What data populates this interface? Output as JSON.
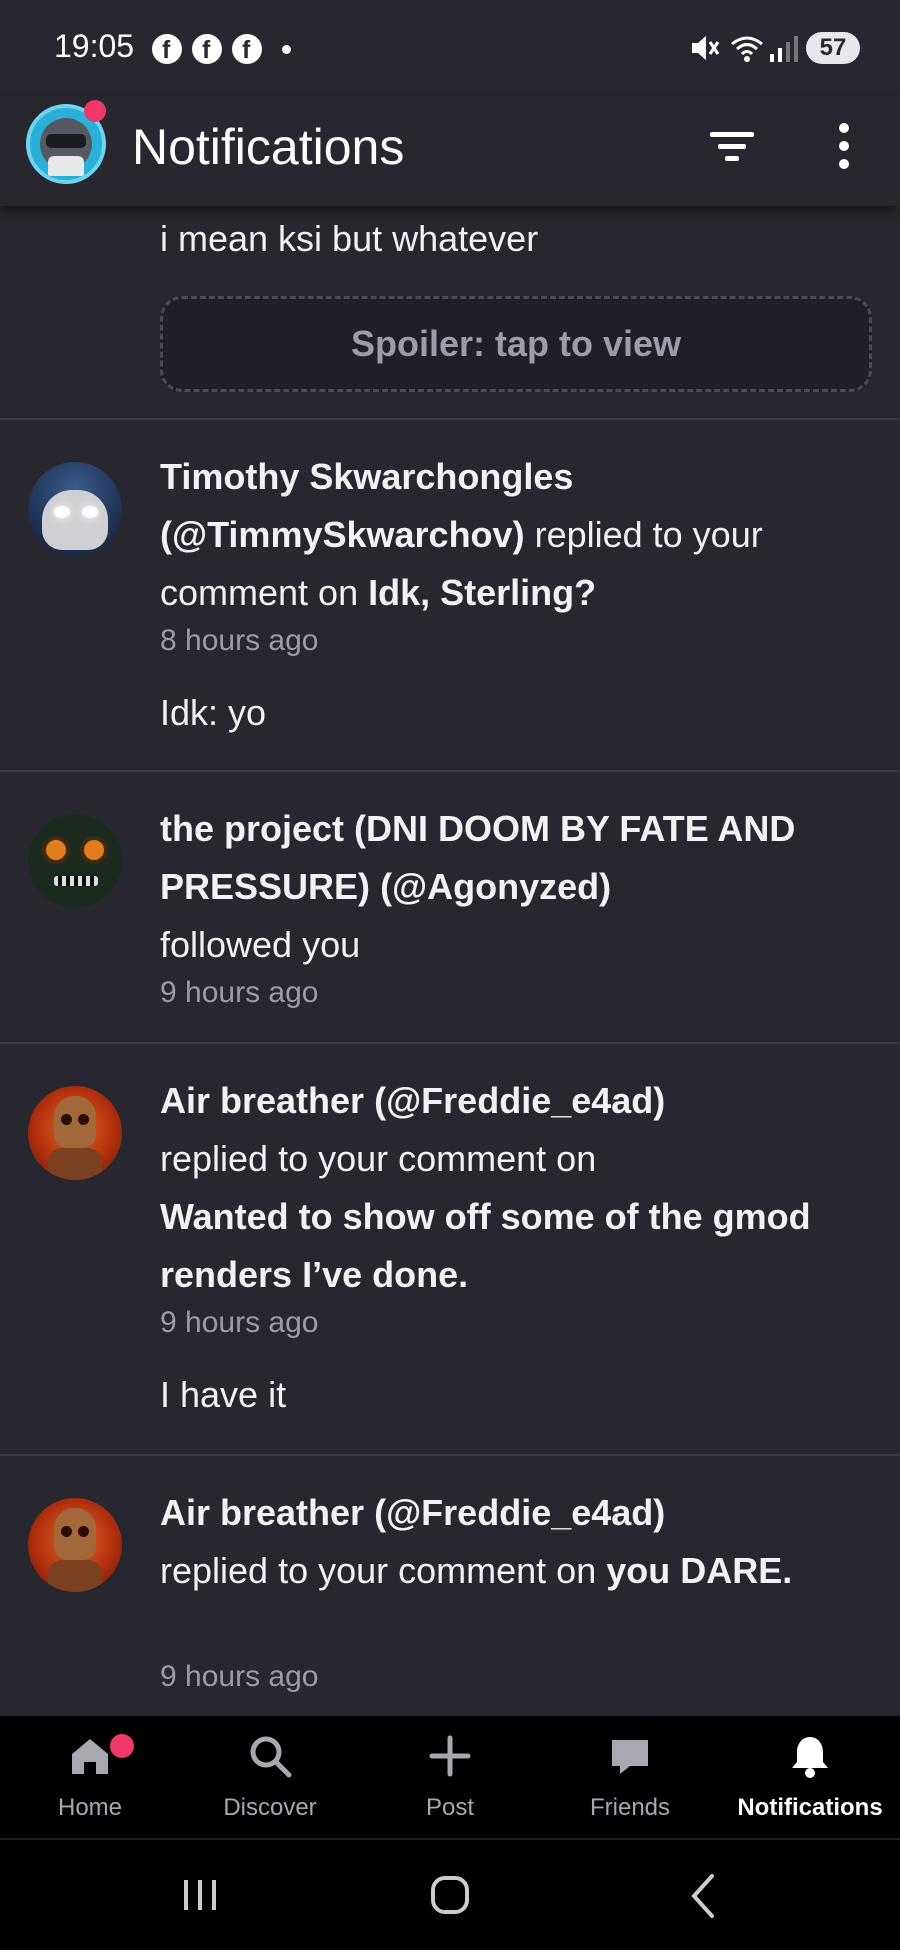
{
  "status_bar": {
    "time": "19:05",
    "battery": "57",
    "notification_icons": [
      "facebook-icon",
      "facebook-icon",
      "facebook-icon"
    ]
  },
  "header": {
    "title": "Notifications"
  },
  "top_snippet": {
    "text": "i mean ksi but whatever",
    "spoiler_label": "Spoiler: tap to view"
  },
  "notifications": [
    {
      "user": "Timothy Skwarchongles",
      "handle": "(@TimmySkwarchov)",
      "action": "replied to your comment on",
      "target": "Idk, Sterling?",
      "time": "8 hours ago",
      "reply": "Idk: yo"
    },
    {
      "user": "the project (DNI DOOM BY FATE AND PRESSURE)",
      "handle": "(@Agonyzed)",
      "action": "followed you",
      "time": "9 hours ago"
    },
    {
      "user": "Air breather",
      "handle": "(@Freddie_e4ad)",
      "action": "replied to your comment on",
      "target": "Wanted to show off some of the gmod renders I’ve done.",
      "time": "9 hours ago",
      "reply": "I have it"
    },
    {
      "user": "Air breather",
      "handle": "(@Freddie_e4ad)",
      "action": "replied to your comment on",
      "target": "you DARE.",
      "time": "9 hours ago"
    }
  ],
  "bottom_nav": {
    "items": [
      {
        "label": "Home",
        "icon": "home-icon"
      },
      {
        "label": "Discover",
        "icon": "search-icon"
      },
      {
        "label": "Post",
        "icon": "plus-icon"
      },
      {
        "label": "Friends",
        "icon": "chat-icon"
      },
      {
        "label": "Notifications",
        "icon": "bell-icon"
      }
    ],
    "active": "Notifications"
  },
  "colors": {
    "background": "#28272f",
    "badge": "#f0396a",
    "muted_text": "#9c9ba6"
  }
}
